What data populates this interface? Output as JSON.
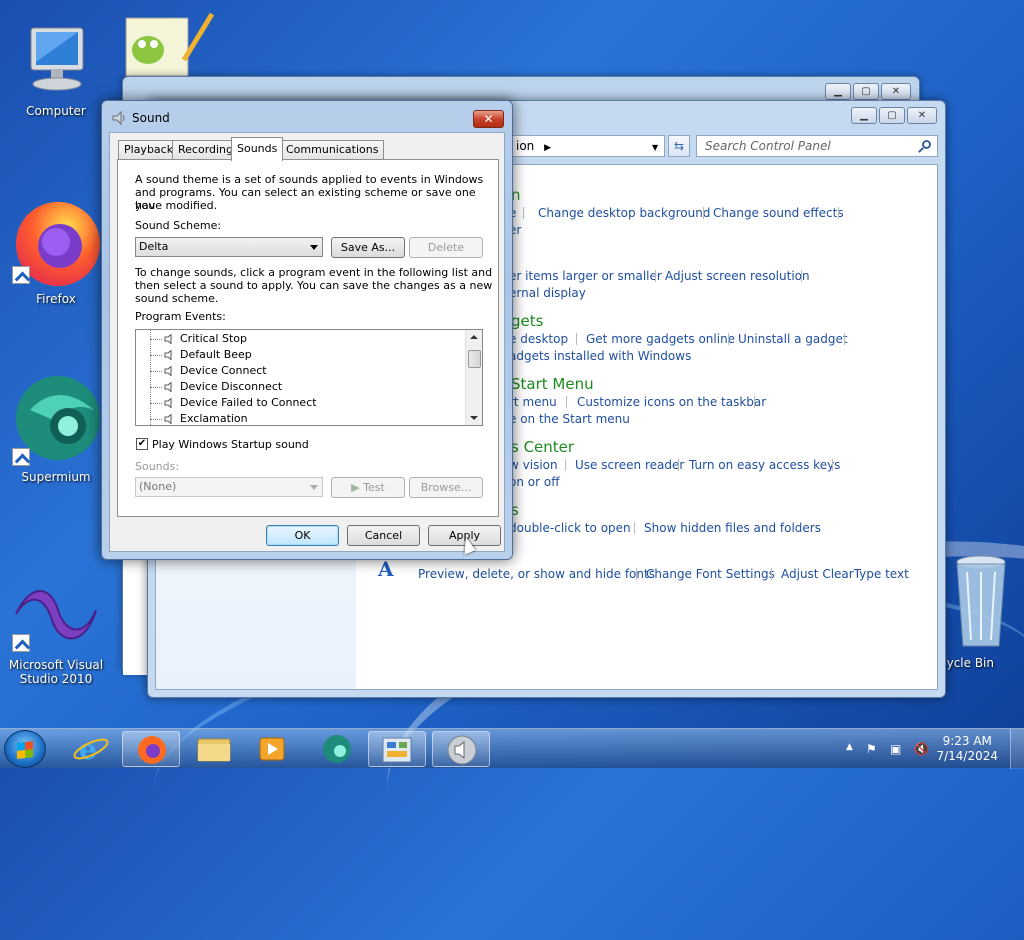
{
  "desktop": {
    "icons": [
      {
        "label": "Computer"
      },
      {
        "label": "Firefox"
      },
      {
        "label": "Supermium"
      },
      {
        "label": "Microsoft Visual Studio 2010"
      },
      {
        "label": "cycle Bin"
      }
    ]
  },
  "control_panel": {
    "address_tail": "ion",
    "search_placeholder": "Search Control Panel",
    "categories": [
      {
        "title": "n",
        "links": [
          "Change desktop background",
          "Change sound effects"
        ],
        "links2": [
          "er"
        ]
      },
      {
        "title": "",
        "links": [
          "er items larger or smaller",
          "Adjust screen resolution"
        ],
        "links2": [
          "ernal display"
        ]
      },
      {
        "title": "gets",
        "links": [
          "e desktop",
          "Get more gadgets online",
          "Uninstall a gadget"
        ],
        "links2": [
          "adgets installed with Windows"
        ]
      },
      {
        "title": "Start Menu",
        "links": [
          "rt menu",
          "Customize icons on the taskbar"
        ],
        "links2": [
          "e on the Start menu"
        ]
      },
      {
        "title": "s Center",
        "links": [
          "w vision",
          "Use screen reader",
          "Turn on easy access keys"
        ],
        "links2": [
          "on or off"
        ]
      },
      {
        "title": "s",
        "links": [
          "double-click to open",
          "Show hidden files and folders"
        ],
        "links2": []
      },
      {
        "title": "",
        "links": [
          "Preview, delete, or show and hide fonts",
          "Change Font Settings",
          "Adjust ClearType text"
        ],
        "links2": []
      }
    ]
  },
  "sound_dialog": {
    "title": "Sound",
    "tabs": [
      "Playback",
      "Recording",
      "Sounds",
      "Communications"
    ],
    "active_tab": "Sounds",
    "intro_lines": [
      "A sound theme is a set of sounds applied to events in Windows",
      "and programs.  You can select an existing scheme or save one you",
      "have modified."
    ],
    "scheme_label": "Sound Scheme:",
    "scheme_value": "Delta",
    "save_as": "Save As...",
    "delete": "Delete",
    "instructions_lines": [
      "To change sounds, click a program event in the following list and",
      "then select a sound to apply.  You can save the changes as a new",
      "sound scheme."
    ],
    "events_label": "Program Events:",
    "events": [
      "Critical Stop",
      "Default Beep",
      "Device Connect",
      "Device Disconnect",
      "Device Failed to Connect",
      "Exclamation"
    ],
    "startup_label": "Play Windows Startup sound",
    "startup_checked": "✔",
    "sounds_label": "Sounds:",
    "sounds_value": "(None)",
    "test": "Test",
    "browse": "Browse...",
    "ok": "OK",
    "cancel": "Cancel",
    "apply": "Apply"
  },
  "taskbar": {
    "time": "9:23 AM",
    "date": "7/14/2024"
  }
}
